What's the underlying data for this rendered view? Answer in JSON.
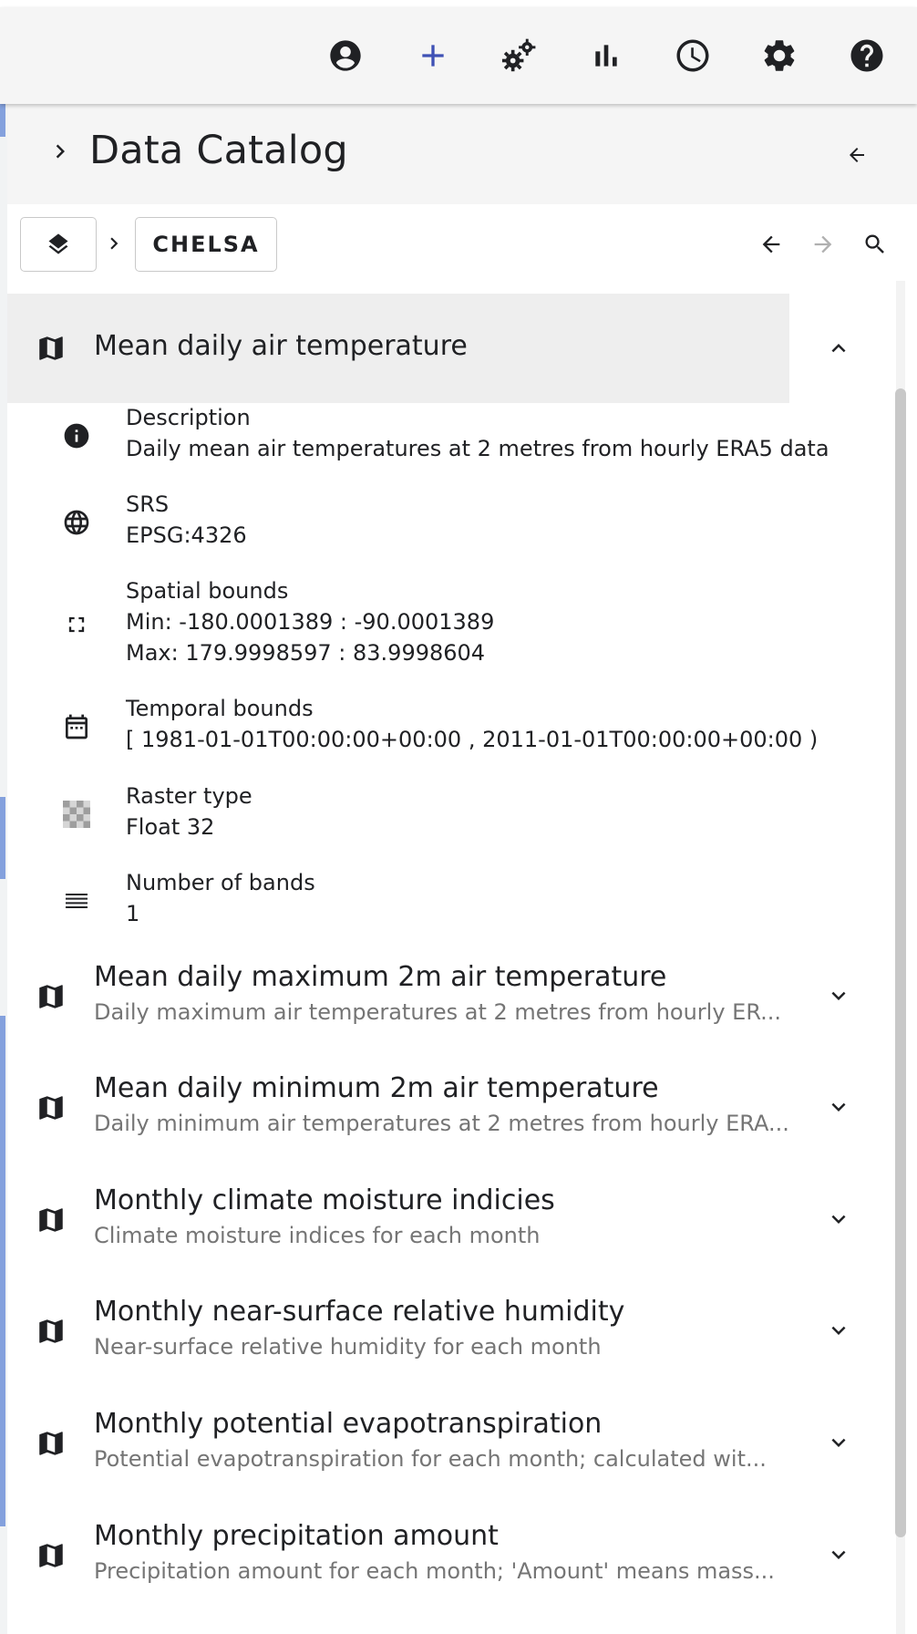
{
  "toolbar": {
    "icons": [
      "account-icon",
      "add-icon",
      "gears-icon",
      "bar-chart-icon",
      "clock-icon",
      "settings-icon",
      "help-icon"
    ],
    "accent_color": "#3f51b5"
  },
  "panel": {
    "title": "Data Catalog"
  },
  "breadcrumb": {
    "root_icon": "layers-icon",
    "current": "CHELSA"
  },
  "expanded_item": {
    "title": "Mean daily air temperature",
    "properties": [
      {
        "icon": "info-icon",
        "label": "Description",
        "value": "Daily mean air temperatures at 2 metres from hourly ERA5 data"
      },
      {
        "icon": "globe-icon",
        "label": "SRS",
        "value": "EPSG:4326"
      },
      {
        "icon": "fullscreen-icon",
        "label": "Spatial bounds",
        "value": "Min: -180.0001389 : -90.0001389",
        "value2": "Max: 179.9998597 : 83.9998604"
      },
      {
        "icon": "calendar-icon",
        "label": "Temporal bounds",
        "value": "[ 1981-01-01T00:00:00+00:00 , 2011-01-01T00:00:00+00:00 )"
      },
      {
        "icon": "checkerboard-icon",
        "label": "Raster type",
        "value": "Float 32"
      },
      {
        "icon": "bands-icon",
        "label": "Number of bands",
        "value": "1"
      }
    ]
  },
  "items": [
    {
      "title": "Mean daily maximum 2m air temperature",
      "subtitle": "Daily maximum air temperatures at 2 metres from hourly ER..."
    },
    {
      "title": "Mean daily minimum 2m air temperature",
      "subtitle": "Daily minimum air temperatures at 2 metres from hourly ERA..."
    },
    {
      "title": "Monthly climate moisture indicies",
      "subtitle": "Climate moisture indices for each month"
    },
    {
      "title": "Monthly near-surface relative humidity",
      "subtitle": "Near-surface relative humidity for each month"
    },
    {
      "title": "Monthly potential evapotranspiration",
      "subtitle": "Potential evapotranspiration for each month; calculated wit..."
    },
    {
      "title": "Monthly precipitation amount",
      "subtitle": "Precipitation amount for each month; 'Amount' means mass..."
    }
  ]
}
